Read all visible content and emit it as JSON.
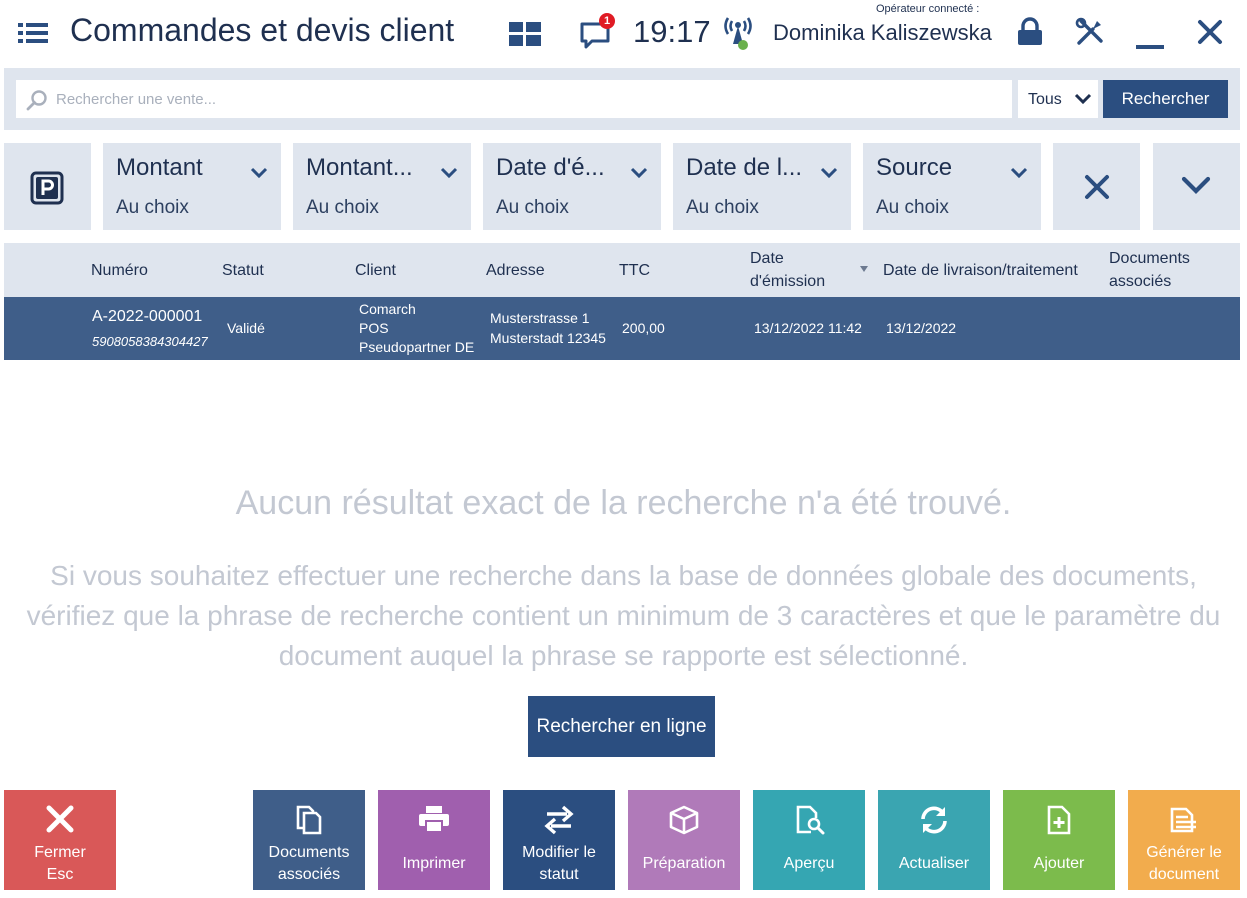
{
  "header": {
    "title": "Commandes et devis client",
    "time": "19:17",
    "notification_count": "1",
    "operator_label": "Opérateur connecté :",
    "operator_name": "Dominika Kaliszewska"
  },
  "search": {
    "placeholder": "Rechercher une vente...",
    "value": "",
    "scope_selected": "Tous",
    "button_label": "Rechercher"
  },
  "filters": [
    {
      "title": "Montant",
      "value": "Au choix"
    },
    {
      "title": "Montant...",
      "value": "Au choix"
    },
    {
      "title": "Date d'é...",
      "value": "Au choix"
    },
    {
      "title": "Date de l...",
      "value": "Au choix"
    },
    {
      "title": "Source",
      "value": "Au choix"
    }
  ],
  "table": {
    "columns": {
      "numero": "Numéro",
      "statut": "Statut",
      "client": "Client",
      "adresse": "Adresse",
      "ttc": "TTC",
      "date_emission_1": "Date",
      "date_emission_2": "d'émission",
      "date_livraison": "Date de livraison/traitement",
      "documents_1": "Documents",
      "documents_2": "associés"
    },
    "rows": [
      {
        "numero": "A-2022-000001",
        "code": "5908058384304427",
        "statut": "Validé",
        "client_1": "Comarch",
        "client_2": "POS",
        "client_3": "Pseudopartner DE",
        "adresse_1": "Musterstrasse 1",
        "adresse_2": "Musterstadt 12345",
        "ttc": "200,00",
        "date_emission": "13/12/2022 11:42",
        "date_livraison": "13/12/2022",
        "documents": ""
      }
    ]
  },
  "empty_state": {
    "title": "Aucun résultat exact de la recherche n'a été trouvé.",
    "line1": "Si vous souhaitez effectuer une recherche dans la base de données globale des documents,",
    "line2": "vérifiez que la phrase de recherche contient un minimum de 3 caractères et que le paramètre du",
    "line3": "document auquel la phrase se rapporte est sélectionné.",
    "online_button": "Rechercher en ligne"
  },
  "actions": {
    "close_1": "Fermer",
    "close_2": "Esc",
    "docs_1": "Documents",
    "docs_2": "associés",
    "print": "Imprimer",
    "status_1": "Modifier le",
    "status_2": "statut",
    "prep": "Préparation",
    "preview": "Aperçu",
    "refresh": "Actualiser",
    "add": "Ajouter",
    "gen_1": "Générer le",
    "gen_2": "document"
  },
  "colors": {
    "accent": "#2b4e80",
    "selected_row": "#3f5e89",
    "close": "#d95858",
    "docs": "#3f5e89",
    "print": "#a05fae",
    "status": "#2b4e80",
    "prep": "#b07ab9",
    "preview": "#35a6b2",
    "refresh": "#3aa5b1",
    "add": "#7cbb4c",
    "generate": "#f2ac4d"
  }
}
